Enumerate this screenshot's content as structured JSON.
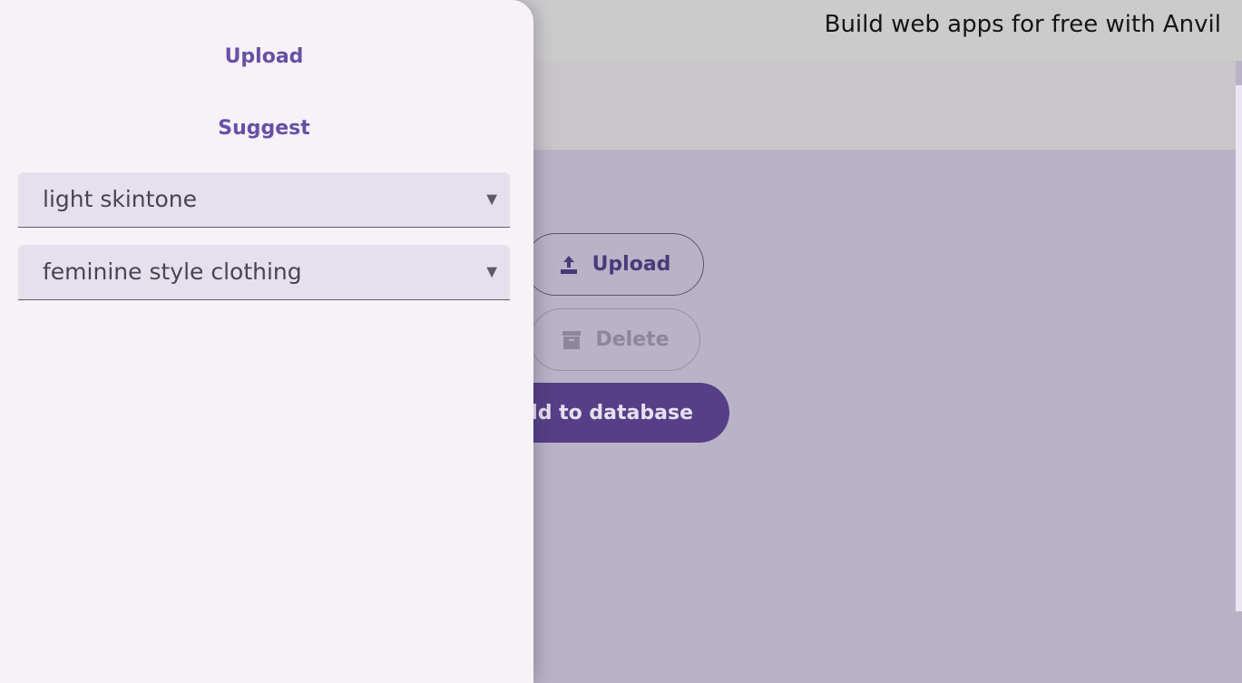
{
  "banner": {
    "text": "Build web apps for free with Anvil"
  },
  "actions": {
    "upload_label": "Upload",
    "delete_label": "Delete",
    "add_label": "Add to database"
  },
  "drawer": {
    "nav_upload": "Upload",
    "nav_suggest": "Suggest",
    "dropdown_skintone": {
      "value": "light skintone",
      "arrow": "▼"
    },
    "dropdown_style": {
      "value": "feminine style clothing",
      "arrow": "▼"
    }
  },
  "colors": {
    "primary": "#6750a4",
    "drawer_bg": "#f6f2f8",
    "scrim_bg": "#bab2c7",
    "add_button": "#563f86"
  },
  "icons": {
    "upload": "upload-icon",
    "delete": "archive-icon"
  }
}
